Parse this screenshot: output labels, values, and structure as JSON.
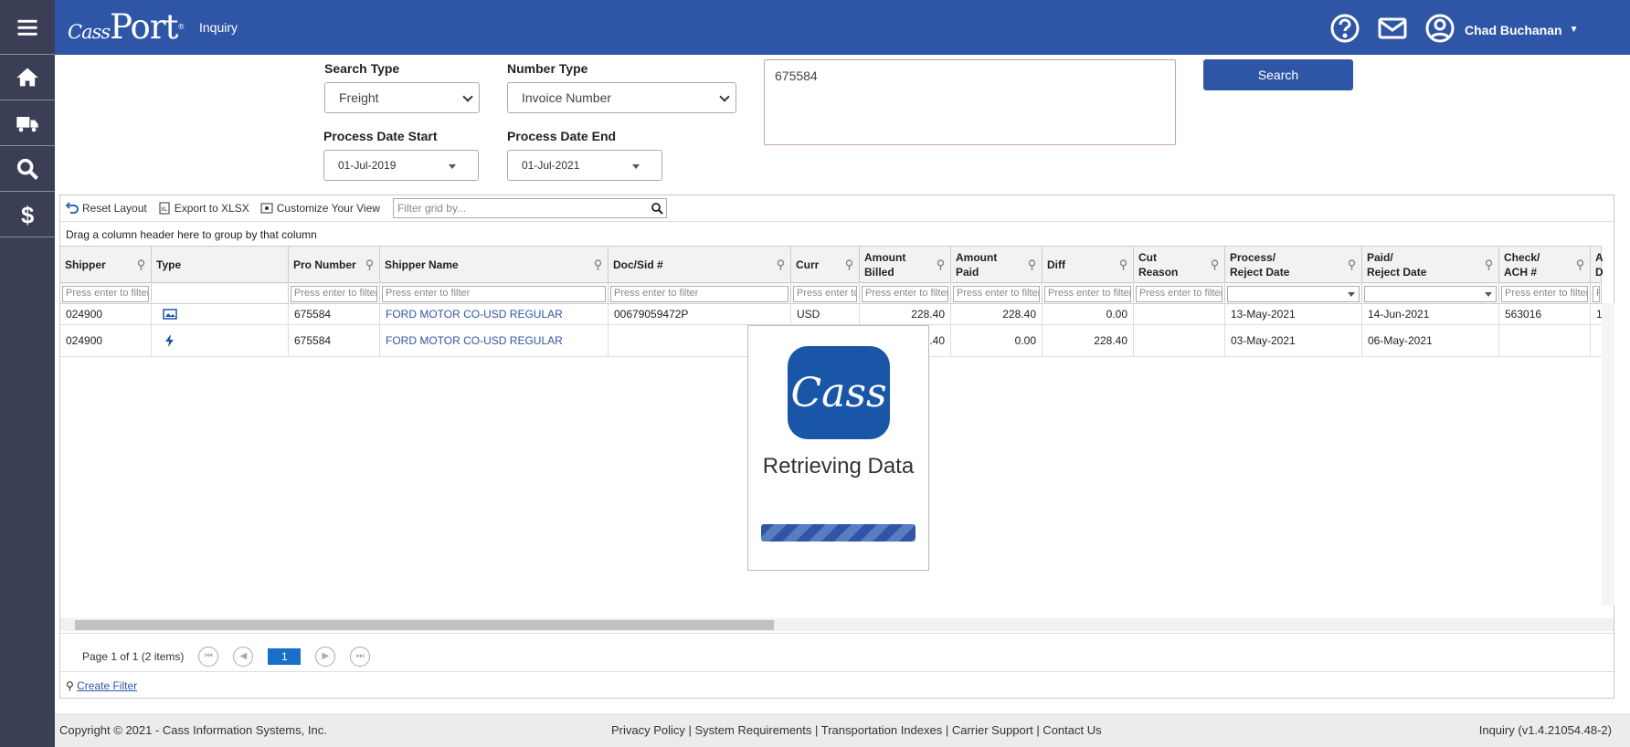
{
  "header": {
    "logo": "CassPort",
    "page": "Inquiry",
    "user": "Chad Buchanan"
  },
  "sidebar": {
    "items": [
      "menu-icon",
      "home-icon",
      "truck-icon",
      "search-icon",
      "dollar-icon"
    ]
  },
  "form": {
    "search_type_label": "Search Type",
    "search_type_value": "Freight",
    "number_type_label": "Number Type",
    "number_type_value": "Invoice Number",
    "start_label": "Process Date Start",
    "start_value": "01-Jul-2019",
    "end_label": "Process Date End",
    "end_value": "01-Jul-2021",
    "numbers_value": "675584",
    "search_button": "Search"
  },
  "toolbar": {
    "reset": "Reset Layout",
    "export": "Export to XLSX",
    "customize": "Customize Your View",
    "filter_placeholder": "Filter grid by..."
  },
  "group_hint": "Drag a column header here to group by that column",
  "filter_placeholder": "Press enter to filter",
  "columns": [
    {
      "l1": "Shipper",
      "l2": ""
    },
    {
      "l1": "Type",
      "l2": ""
    },
    {
      "l1": "Pro Number",
      "l2": ""
    },
    {
      "l1": "Shipper Name",
      "l2": ""
    },
    {
      "l1": "Doc/Sid #",
      "l2": ""
    },
    {
      "l1": "Curr",
      "l2": ""
    },
    {
      "l1": "Amount",
      "l2": "Billed"
    },
    {
      "l1": "Amount",
      "l2": "Paid"
    },
    {
      "l1": "Diff",
      "l2": ""
    },
    {
      "l1": "Cut",
      "l2": "Reason"
    },
    {
      "l1": "Process/",
      "l2": "Reject Date"
    },
    {
      "l1": "Paid/",
      "l2": "Reject Date"
    },
    {
      "l1": "Check/",
      "l2": "ACH #"
    },
    {
      "l1": "A",
      "l2": "D"
    }
  ],
  "rows": [
    {
      "shipper": "024900",
      "type": "image-icon",
      "pro": "675584",
      "name": "FORD MOTOR CO-USD REGULAR",
      "doc": "00679059472P",
      "curr": "USD",
      "billed": "228.40",
      "paid": "228.40",
      "diff": "0.00",
      "cut": "",
      "process": "13-May-2021",
      "paid_date": "14-Jun-2021",
      "check": "563016",
      "extra": "1"
    },
    {
      "shipper": "024900",
      "type": "bolt-icon",
      "pro": "675584",
      "name": "FORD MOTOR CO-USD REGULAR",
      "doc": "",
      "curr": "",
      "billed": "228.40",
      "paid": "0.00",
      "diff": "228.40",
      "cut": "",
      "process": "03-May-2021",
      "paid_date": "06-May-2021",
      "check": "",
      "extra": ""
    }
  ],
  "pager": {
    "info": "Page 1 of 1 (2 items)",
    "page": "1"
  },
  "create_filter": "Create Filter",
  "modal": {
    "logo": "Cass",
    "title": "Retrieving Data"
  },
  "footer": {
    "copyright": "Copyright © 2021 - Cass Information Systems, Inc.",
    "links": "Privacy Policy  | System Requirements  | Transportation Indexes  | Carrier Support  | Contact Us",
    "version": "Inquiry (v1.4.21054.48-2)"
  }
}
